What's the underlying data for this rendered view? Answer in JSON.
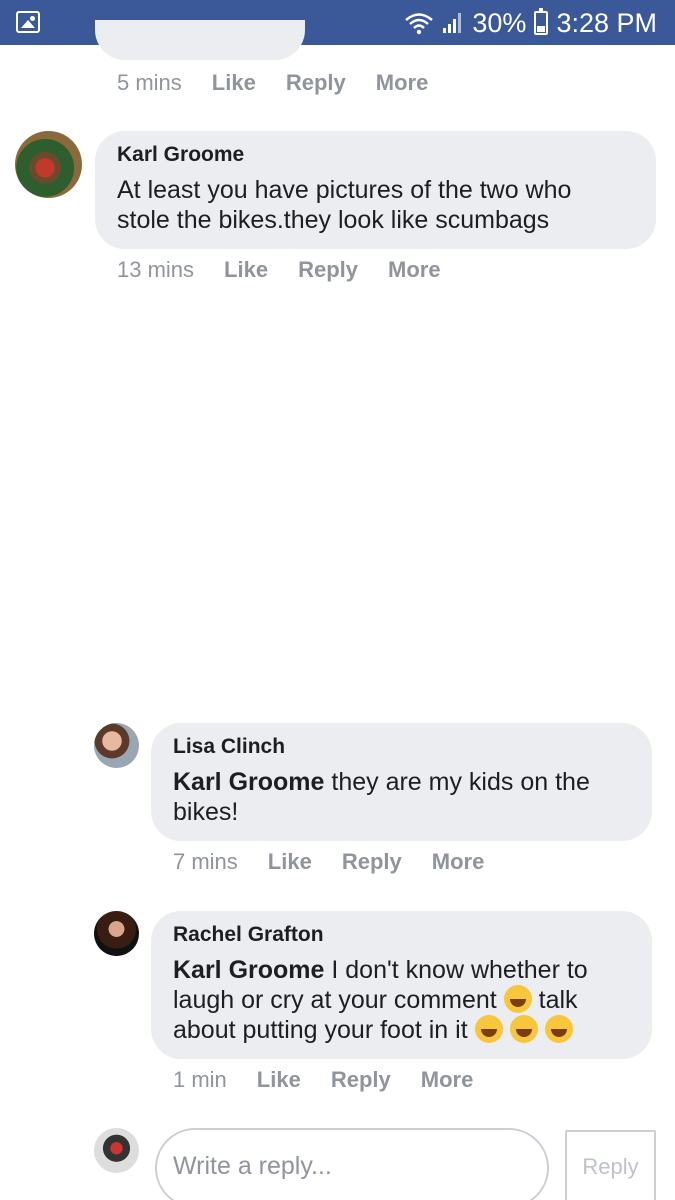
{
  "status_bar": {
    "battery": "30%",
    "time": "3:28 PM"
  },
  "actions": {
    "like": "Like",
    "reply": "Reply",
    "more": "More"
  },
  "comments": [
    {
      "time": "5 mins"
    },
    {
      "author": "Karl Groome",
      "text_line1": "At least you have pictures of the two who",
      "text_line2": "stole the bikes.they look like scumbags",
      "time": "13 mins"
    },
    {
      "author": "Lisa Clinch",
      "mention": "Karl Groome",
      "text_line1": " they are my kids on the",
      "text_line2": "bikes!",
      "time": "7 mins"
    },
    {
      "author": "Rachel Grafton",
      "mention": "Karl Groome",
      "text_line1": " I don't know whether to",
      "text_line2a": "laugh or cry at your comment ",
      "text_line2b": " talk",
      "text_line3": "about putting your foot in it ",
      "time": "1 min"
    }
  ],
  "reply_box": {
    "placeholder": "Write a reply...",
    "button": "Reply"
  },
  "icons": {
    "gallery": "image-icon",
    "wifi": "wifi-icon",
    "signal": "signal-icon",
    "battery": "battery-icon"
  },
  "colors": {
    "status_bar": "#3b5998",
    "bubble": "#ebedf0",
    "meta": "#90949c"
  }
}
